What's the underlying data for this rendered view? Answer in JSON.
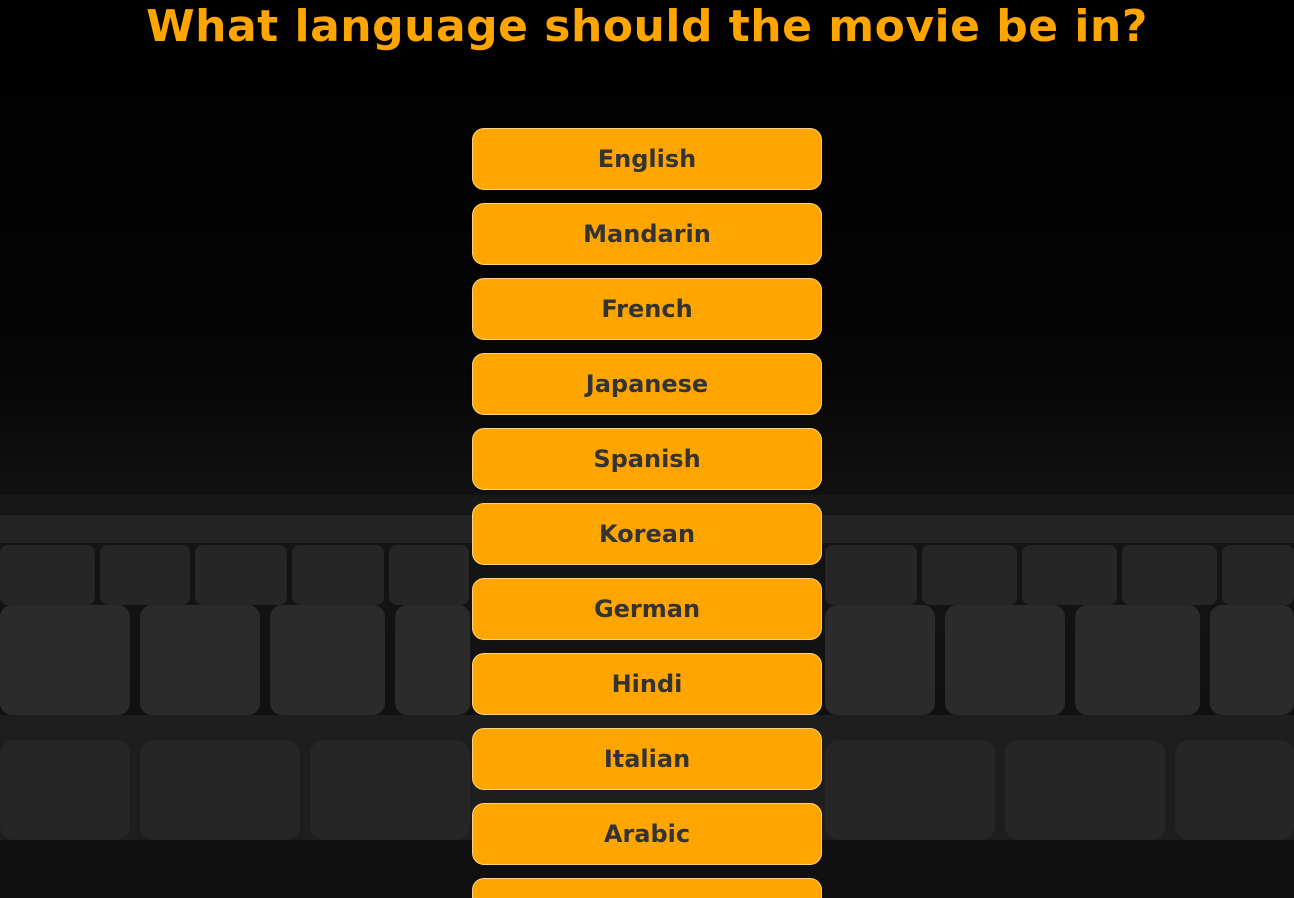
{
  "question": "What language should the movie be in?",
  "options": [
    "English",
    "Mandarin",
    "French",
    "Japanese",
    "Spanish",
    "Korean",
    "German",
    "Hindi",
    "Italian",
    "Arabic",
    ""
  ],
  "colors": {
    "accent": "#FFA500",
    "button_text": "#333333",
    "background": "#000000"
  }
}
